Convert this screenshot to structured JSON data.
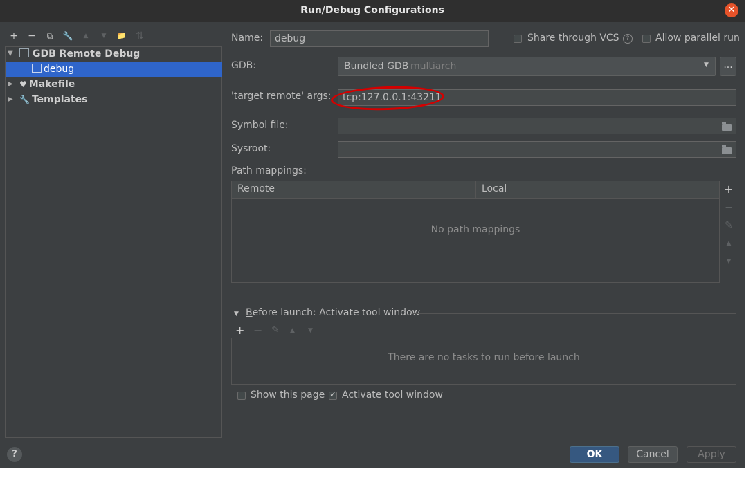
{
  "window": {
    "title": "Run/Debug Configurations",
    "close_glyph": "✕"
  },
  "toolbar": {
    "add": "+",
    "remove": "−",
    "copy": "⧉",
    "edit": "🔧",
    "up": "▲",
    "down": "▼",
    "folder": "📁",
    "sort": "⇅"
  },
  "tree": {
    "group": "GDB Remote Debug",
    "selected_item": "debug",
    "makefile": "Makefile",
    "templates": "Templates"
  },
  "form": {
    "name_label_u": "N",
    "name_label_rest": "ame:",
    "name_value": "debug",
    "share_label_u": "S",
    "share_label_rest": "hare through VCS",
    "help_glyph": "?",
    "parallel_label_pre": "Allow parallel ",
    "parallel_label_u": "r",
    "parallel_label_rest": "un",
    "gdb_label": "GDB:",
    "gdb_value": "Bundled GDB",
    "gdb_value_suffix": "multiarch",
    "gdb_more": "...",
    "target_label": "'target remote' args:",
    "target_value": "tcp:127.0.0.1:43211",
    "symbol_label": "Symbol file:",
    "symbol_value": "",
    "sysroot_label": "Sysroot:",
    "sysroot_value": ""
  },
  "path_mappings": {
    "label": "Path mappings:",
    "columns": [
      "Remote",
      "Local"
    ],
    "empty_text": "No path mappings",
    "add": "+",
    "remove": "−",
    "edit": "✎",
    "up": "▲",
    "down": "▼"
  },
  "before_launch": {
    "heading_u": "B",
    "heading_rest": "efore launch: Activate tool window",
    "add": "+",
    "remove": "−",
    "edit": "✎",
    "up": "▲",
    "down": "▼",
    "empty_text": "There are no tasks to run before launch",
    "show_page_label": "Show this page",
    "show_page_checked": false,
    "activate_label": "Activate tool window",
    "activate_checked": true
  },
  "footer": {
    "help": "?",
    "ok": "OK",
    "cancel": "Cancel",
    "apply": "Apply"
  },
  "colors": {
    "accent": "#2f65ca",
    "annotation": "#d40000",
    "close": "#e6532a"
  }
}
